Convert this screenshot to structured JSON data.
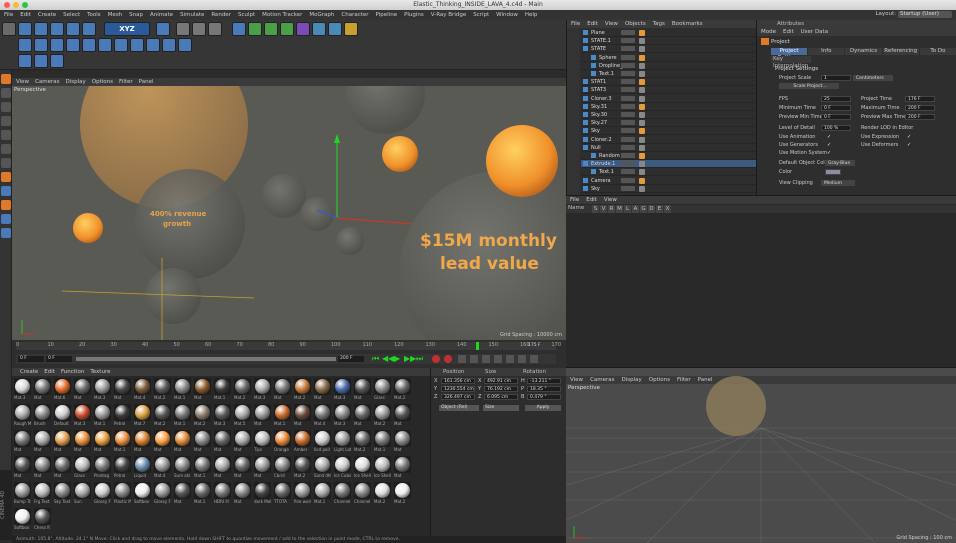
{
  "window": {
    "title": "Elastic_Thinking_INSIDE_LAVA_4.c4d - Main",
    "layout_label": "Layout:",
    "layout_value": "Startup (User)"
  },
  "menu": [
    "File",
    "Edit",
    "Create",
    "Select",
    "Tools",
    "Mesh",
    "Snap",
    "Animate",
    "Simulate",
    "Render",
    "Sculpt",
    "Motion Tracker",
    "MoGraph",
    "Character",
    "Pipeline",
    "Plugins",
    "V-Ray Bridge",
    "Script",
    "Window",
    "Help"
  ],
  "viewport": {
    "menu": [
      "View",
      "Cameras",
      "Display",
      "Options",
      "Filter",
      "Panel"
    ],
    "label": "Perspective",
    "grid_spacing": "Grid Spacing : 10000 cm",
    "text_left_line1": "400% revenue",
    "text_left_line2": "growth",
    "text_right_line1": "$15M monthly",
    "text_right_line2": "lead value"
  },
  "timeline": {
    "ticks": [
      "0",
      "10",
      "20",
      "30",
      "40",
      "50",
      "60",
      "70",
      "80",
      "90",
      "100",
      "110",
      "120",
      "130",
      "140",
      "150",
      "160",
      "170"
    ],
    "current_frame": "176",
    "start": "0 F",
    "start2": "0 F",
    "end": "200 F",
    "end2": "175 F",
    "total": "170 F"
  },
  "materials": {
    "menu": [
      "Create",
      "Edit",
      "Function",
      "Texture"
    ],
    "items": [
      {
        "name": "Mat.3",
        "color": "#d8d8d8"
      },
      {
        "name": "Mat",
        "color": "#777"
      },
      {
        "name": "Mat.6",
        "color": "#e06a2a"
      },
      {
        "name": "Mat",
        "color": "#6a6a6a"
      },
      {
        "name": "Mat.3",
        "color": "#999"
      },
      {
        "name": "Mat",
        "color": "#4a4a4a"
      },
      {
        "name": "Mat.4",
        "color": "#7a5a3a"
      },
      {
        "name": "Mat.2",
        "color": "#5a5a5a"
      },
      {
        "name": "Mat.1",
        "color": "#888"
      },
      {
        "name": "Mat",
        "color": "#8a5a2a"
      },
      {
        "name": "Mat.1",
        "color": "#3a3a3a"
      },
      {
        "name": "Mat.2",
        "color": "#666"
      },
      {
        "name": "Mat.3",
        "color": "#aaa"
      },
      {
        "name": "Mat",
        "color": "#777"
      },
      {
        "name": "Mat.2",
        "color": "#c87a3a"
      },
      {
        "name": "Mat",
        "color": "#8a6a4a"
      },
      {
        "name": "Mat.3",
        "color": "#4a6aaa"
      },
      {
        "name": "Mat",
        "color": "#555"
      },
      {
        "name": "Glass",
        "color": "#888"
      },
      {
        "name": "Mat.2",
        "color": "#666"
      },
      {
        "name": "Rough M",
        "color": "#aaa"
      },
      {
        "name": "Brush",
        "color": "#888"
      },
      {
        "name": "Default",
        "color": "#ccc"
      },
      {
        "name": "Mat.3",
        "color": "#c84a2a"
      },
      {
        "name": "Mat.1",
        "color": "#999"
      },
      {
        "name": "Petrol",
        "color": "#3a3a3a"
      },
      {
        "name": "Mat.7",
        "color": "#d8a040"
      },
      {
        "name": "Mat.2",
        "color": "#555"
      },
      {
        "name": "Mat.1",
        "color": "#777"
      },
      {
        "name": "Mat.2",
        "color": "#8a7a6a"
      },
      {
        "name": "Mat.3",
        "color": "#5a5a5a"
      },
      {
        "name": "Mat.5",
        "color": "#aaa"
      },
      {
        "name": "Mat",
        "color": "#999"
      },
      {
        "name": "Mat.1",
        "color": "#c86a2a"
      },
      {
        "name": "Mat",
        "color": "#6a4a3a"
      },
      {
        "name": "Mat.4",
        "color": "#777"
      },
      {
        "name": "Mat.3",
        "color": "#888"
      },
      {
        "name": "Mat",
        "color": "#666"
      },
      {
        "name": "Mat.2",
        "color": "#999"
      },
      {
        "name": "Mat",
        "color": "#555"
      },
      {
        "name": "Mat",
        "color": "#777"
      },
      {
        "name": "Mat",
        "color": "#aaa"
      },
      {
        "name": "Mat",
        "color": "#e0a050"
      },
      {
        "name": "Mat",
        "color": "#e8903a"
      },
      {
        "name": "Mat",
        "color": "#e8a040"
      },
      {
        "name": "Mat.1",
        "color": "#e89040"
      },
      {
        "name": "Mat",
        "color": "#d88030"
      },
      {
        "name": "Mat",
        "color": "#ffa040"
      },
      {
        "name": "Mat",
        "color": "#e08a3a"
      },
      {
        "name": "Mat",
        "color": "#888"
      },
      {
        "name": "Mat",
        "color": "#666"
      },
      {
        "name": "Mat",
        "color": "#aaa"
      },
      {
        "name": "Tips",
        "color": "#bbb"
      },
      {
        "name": "Orange",
        "color": "#e88a3a"
      },
      {
        "name": "Amber",
        "color": "#c86a2a"
      },
      {
        "name": "Ilxd poll",
        "color": "#ccc"
      },
      {
        "name": "Light Lat",
        "color": "#999"
      },
      {
        "name": "Mat.2",
        "color": "#666"
      },
      {
        "name": "Mat.1",
        "color": "#777"
      },
      {
        "name": "Mat",
        "color": "#888"
      },
      {
        "name": "Mat",
        "color": "#555"
      },
      {
        "name": "Mat",
        "color": "#888"
      },
      {
        "name": "Mat",
        "color": "#6a6a6a"
      },
      {
        "name": "Glass",
        "color": "#bbb"
      },
      {
        "name": "Pinetag",
        "color": "#777"
      },
      {
        "name": "Petrol",
        "color": "#444"
      },
      {
        "name": "Liquid",
        "color": "#6a8aaa"
      },
      {
        "name": "Mat.4",
        "color": "#999"
      },
      {
        "name": "Sum ats",
        "color": "#888"
      },
      {
        "name": "Mat.1",
        "color": "#777"
      },
      {
        "name": "Mat",
        "color": "#aaa"
      },
      {
        "name": "Mat",
        "color": "#666"
      },
      {
        "name": "Mat",
        "color": "#999"
      },
      {
        "name": "Cbrid",
        "color": "#888"
      },
      {
        "name": "Mat.2",
        "color": "#555"
      },
      {
        "name": "Sand dhl",
        "color": "#aaa"
      },
      {
        "name": "Ice Cubs",
        "color": "#ccc"
      },
      {
        "name": "Ice Shell",
        "color": "#ddd"
      },
      {
        "name": "Ice Shell",
        "color": "#bbb"
      },
      {
        "name": "Mat",
        "color": "#777"
      },
      {
        "name": "Bump Tri",
        "color": "#999"
      },
      {
        "name": "Frg Text",
        "color": "#bbb"
      },
      {
        "name": "Sky Text",
        "color": "#888"
      },
      {
        "name": "Sun",
        "color": "#aaa"
      },
      {
        "name": "Glossy F",
        "color": "#ccc"
      },
      {
        "name": "Plastic M",
        "color": "#888"
      },
      {
        "name": "Softbox",
        "color": "#eee"
      },
      {
        "name": "Glossy F",
        "color": "#999"
      },
      {
        "name": "Mat",
        "color": "#555"
      },
      {
        "name": "Mat.1",
        "color": "#666"
      },
      {
        "name": "HDRI Ill",
        "color": "#777"
      },
      {
        "name": "Mat",
        "color": "#888"
      },
      {
        "name": "dark Met",
        "color": "#444"
      },
      {
        "name": "TTOTA",
        "color": "#666"
      },
      {
        "name": "fine worl",
        "color": "#999"
      },
      {
        "name": "Mat.1",
        "color": "#aaa"
      },
      {
        "name": "Channel",
        "color": "#777"
      },
      {
        "name": "Channel",
        "color": "#888"
      },
      {
        "name": "Mat.2",
        "color": "#ddd"
      },
      {
        "name": "Mat.2",
        "color": "#eee"
      },
      {
        "name": "Softbox",
        "color": "#f0f0f0"
      },
      {
        "name": "Chess R",
        "color": "#555"
      }
    ]
  },
  "coords": {
    "headers": [
      "Position",
      "Size",
      "Rotation"
    ],
    "rows": [
      {
        "axis": "X",
        "pos": "161.356 cm",
        "saxis": "X",
        "size": "492.91 cm",
        "raxis": "H",
        "rot": "-13.211 °"
      },
      {
        "axis": "Y",
        "pos": "1230.554 cm",
        "saxis": "Y",
        "size": "76.192 cm",
        "raxis": "P",
        "rot": "18.35 °"
      },
      {
        "axis": "Z",
        "pos": "326.497 cm",
        "saxis": "Z",
        "size": "6.095 cm",
        "raxis": "B",
        "rot": "0.479 °"
      }
    ],
    "mode1": "Object (Rel)",
    "mode2": "Size",
    "apply": "Apply"
  },
  "objects": {
    "menu": [
      "File",
      "Edit",
      "View",
      "Objects",
      "Tags",
      "Bookmarks"
    ],
    "rows": [
      "Plane",
      "STATE.1",
      "STATE",
      "Sphere",
      "Dropline_F",
      "Text.1",
      "STAT1",
      "STAT3",
      "Cloner.3",
      "Sky.31",
      "Sky.30",
      "Sky.27",
      "Sky",
      "Cloner.2",
      "Null",
      "Random",
      "Extrude.1",
      "Text.1",
      "Camera",
      "Sky"
    ]
  },
  "attributes": {
    "title": "Attributes",
    "menu": [
      "Mode",
      "Edit",
      "User Data"
    ],
    "object": "Project",
    "tabs": [
      "Project Settings",
      "Info",
      "Dynamics",
      "Referencing",
      "To Do"
    ],
    "subtab": "Key Interpolation",
    "section": "Project Settings",
    "scale_label": "Project Scale",
    "scale_value": "1",
    "scale_unit": "Centimeters",
    "scale_btn": "Scale Project...",
    "fps_label": "FPS",
    "fps": "25",
    "project_time_label": "Project Time",
    "project_time": "176 F",
    "min_time_label": "Minimum Time",
    "min_time": "0 F",
    "max_time_label": "Maximum Time",
    "max_time": "200 F",
    "prev_min_label": "Preview Min Time",
    "prev_min": "0 F",
    "prev_max_label": "Preview Max Time",
    "prev_max": "200 F",
    "lod_label": "Level of Detail",
    "lod": "100 %",
    "render_lod": "Render LOD in Editor",
    "use_anim": "Use Animation",
    "use_expr": "Use Expression",
    "use_gen": "Use Generators",
    "use_def": "Use Deformers",
    "use_motion": "Use Motion System",
    "def_color_label": "Default Object Color",
    "def_color": "Gray-Blue",
    "color_label": "Color",
    "clip_label": "View Clipping",
    "clip": "Medium"
  },
  "layers": {
    "menu": [
      "File",
      "Edit",
      "View"
    ],
    "header": "Name",
    "cols": [
      "S",
      "V",
      "R",
      "M",
      "L",
      "A",
      "G",
      "D",
      "E",
      "X"
    ]
  },
  "viewport2": {
    "menu": [
      "View",
      "Cameras",
      "Display",
      "Options",
      "Filter",
      "Panel"
    ],
    "label": "Perspective",
    "grid_spacing": "Grid Spacing : 100 cm"
  },
  "status": "Azimuth: 105.8°, Altitude: 24.1°  N    Move: Click and drag to move elements. Hold down SHIFT to quantize movement / add to the selection in point mode, CTRL to remove."
}
